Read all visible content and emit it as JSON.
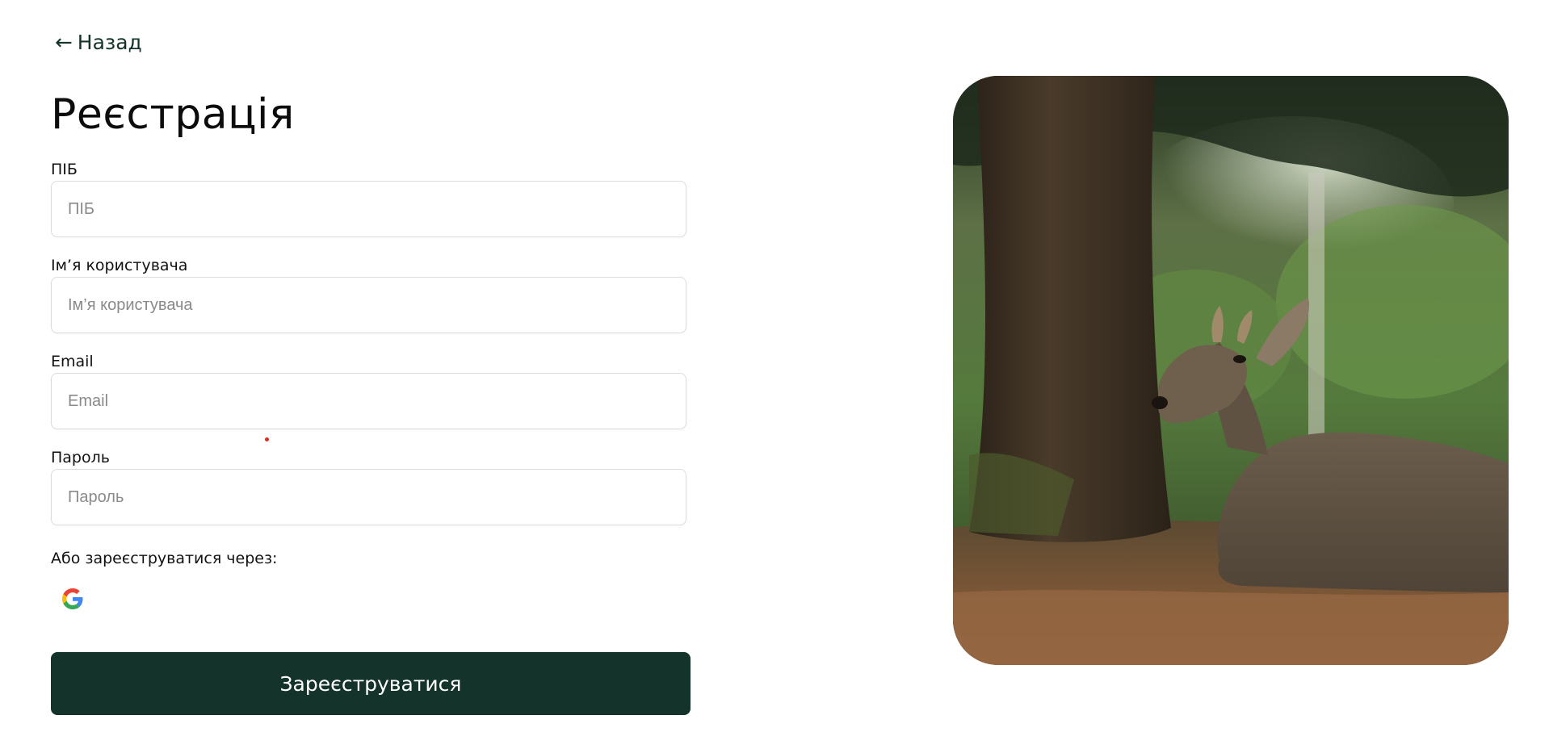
{
  "nav": {
    "back_arrow": "←",
    "back_label": "Назад"
  },
  "page": {
    "title": "Реєстрація"
  },
  "form": {
    "fields": [
      {
        "label": "ПІБ",
        "placeholder": "ПІБ",
        "value": ""
      },
      {
        "label": "Ім’я користувача",
        "placeholder": "Ім’я користувача",
        "value": ""
      },
      {
        "label": "Email",
        "placeholder": "Email",
        "value": ""
      },
      {
        "label": "Пароль",
        "placeholder": "Пароль",
        "value": ""
      }
    ],
    "social_label": "Або зареєструватися через:",
    "social_providers": [
      {
        "icon": "google-icon"
      }
    ],
    "submit_label": "Зареєструватися"
  },
  "hero": {
    "icon": "deer-photo"
  },
  "colors": {
    "primary": "#14342b",
    "background": "#ffffff",
    "input_border": "#dcdcdc",
    "placeholder": "#8a8a8a",
    "google_blue": "#4285F4",
    "google_red": "#EA4335",
    "google_yellow": "#FBBC05",
    "google_green": "#34A853"
  }
}
